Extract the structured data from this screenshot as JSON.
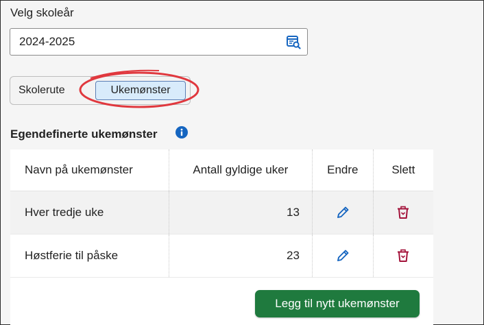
{
  "year_selector": {
    "label": "Velg skoleår",
    "value": "2024-2025",
    "icon": "calendar-search-icon"
  },
  "view_toggle": {
    "options": [
      "Skolerute",
      "Ukemønster"
    ],
    "selected": "Ukemønster"
  },
  "section": {
    "title": "Egendefinerte ukemønster",
    "info_icon": "info-icon"
  },
  "table": {
    "headers": [
      "Navn på ukemønster",
      "Antall gyldige uker",
      "Endre",
      "Slett"
    ],
    "rows": [
      {
        "name": "Hver tredje uke",
        "weeks": "13"
      },
      {
        "name": "Høstferie til påske",
        "weeks": "23"
      }
    ]
  },
  "add_button": {
    "label": "Legg til nytt ukemønster"
  },
  "colors": {
    "accent_blue": "#1565c0",
    "delete_red": "#a3123a",
    "primary_green": "#1f7a3e",
    "annotation_red": "#e0383e",
    "selected_fill": "#d8ebfb"
  }
}
